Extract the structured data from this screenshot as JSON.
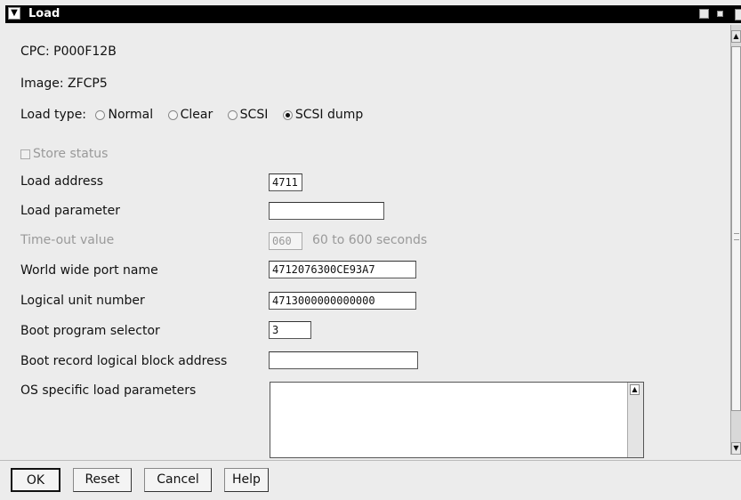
{
  "window": {
    "title": "Load",
    "icons": {
      "system_menu": "system-menu-icon",
      "minimize": "minimize-icon",
      "maximize": "maximize-icon",
      "close": "close-icon"
    }
  },
  "info": {
    "cpc": "CPC:  P000F12B",
    "image": "Image:  ZFCP5"
  },
  "load_type": {
    "label": "Load type:",
    "options": [
      {
        "label": "Normal",
        "selected": false
      },
      {
        "label": "Clear",
        "selected": false
      },
      {
        "label": "SCSI",
        "selected": false
      },
      {
        "label": "SCSI dump",
        "selected": true
      }
    ]
  },
  "store_status": {
    "label": "Store status",
    "checked": false,
    "enabled": false
  },
  "fields": {
    "load_address": {
      "label": "Load address",
      "value": "4711"
    },
    "load_parameter": {
      "label": "Load parameter",
      "value": ""
    },
    "timeout": {
      "label": "Time-out value",
      "value": "060",
      "hint": "60 to 600 seconds",
      "enabled": false
    },
    "wwpn": {
      "label": "World wide port name",
      "value": "4712076300CE93A7"
    },
    "lun": {
      "label": "Logical unit number",
      "value": "4713000000000000"
    },
    "boot_program_selector": {
      "label": "Boot program selector",
      "value": "3"
    },
    "boot_record_lba": {
      "label": "Boot record logical block address",
      "value": ""
    },
    "os_params": {
      "label": "OS specific load parameters",
      "value": ""
    }
  },
  "buttons": {
    "ok": "OK",
    "reset": "Reset",
    "cancel": "Cancel",
    "help": "Help"
  }
}
